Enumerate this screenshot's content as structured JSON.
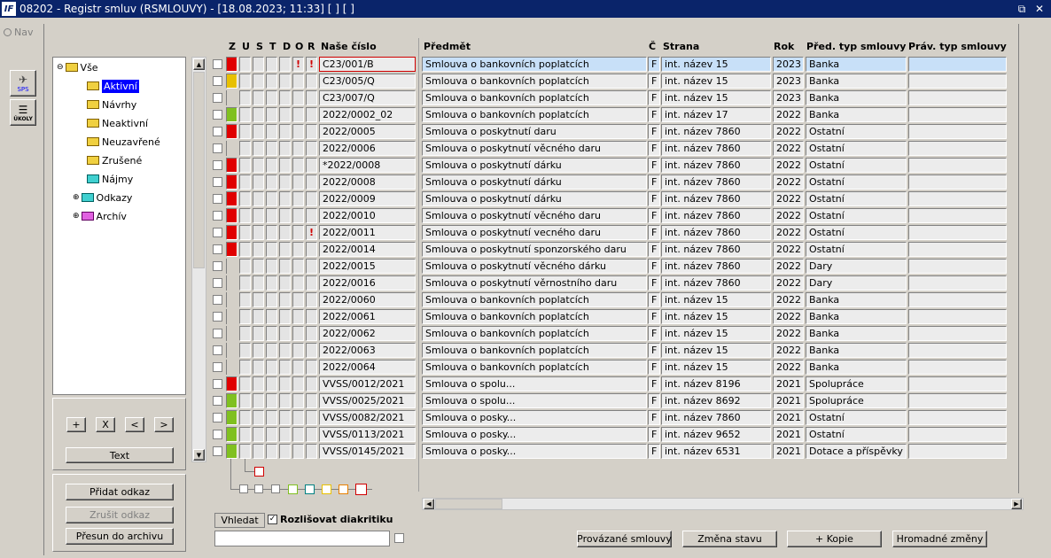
{
  "window": {
    "title": "08202 - Registr smluv (RSMLOUVY) - [18.08.2023; 11:33]  [ ] [ ]",
    "logo": "IF"
  },
  "nav": {
    "label": "Nav"
  },
  "side_icons": {
    "sps": "SPS",
    "ukoly": "ÚKOLY"
  },
  "tree": {
    "items": [
      "Vše",
      "Aktivní",
      "Návrhy",
      "Neaktivní",
      "Neuzavřené",
      "Zrušené",
      "Nájmy",
      "Odkazy",
      "Archív"
    ]
  },
  "tree_buttons": {
    "plus": "+",
    "x": "X",
    "lt": "<",
    "gt": ">",
    "text": "Text"
  },
  "link_buttons": {
    "add": "Přidat odkaz",
    "remove": "Zrušit odkaz",
    "archive": "Přesun do archivu"
  },
  "search": {
    "button": "Vhledat",
    "option": "Rozlišovat diakritiku",
    "value": ""
  },
  "status_letters": [
    "Z",
    "U",
    "S",
    "T",
    "D",
    "O",
    "R"
  ],
  "columns": {
    "cislo": "Naše číslo",
    "predmet": "Předmět",
    "c": "Č",
    "strana": "Strana",
    "rok": "Rok",
    "pred": "Před. typ smlouvy",
    "prav": "Práv. typ smlouvy"
  },
  "colors": {
    "red": "#e00000",
    "yellow": "#e8c000",
    "green": "#80c020",
    "titlebar": "#0a246a",
    "selection": "#0000ff"
  },
  "rows": [
    {
      "z": "red",
      "d": "!",
      "o": "!",
      "cislo": "C23/001/B",
      "predmet": "Smlouva o bankovních poplatcích",
      "c": "F",
      "strana": "int. název 15",
      "rok": "2023",
      "pred": "Banka"
    },
    {
      "z": "yellow",
      "cislo": "C23/005/Q",
      "predmet": "Smlouva o bankovních poplatcích",
      "c": "F",
      "strana": "int. název 15",
      "rok": "2023",
      "pred": "Banka"
    },
    {
      "z": "",
      "cislo": "C23/007/Q",
      "predmet": "Smlouva o bankovních poplatcích",
      "c": "F",
      "strana": "int. název 15",
      "rok": "2023",
      "pred": "Banka"
    },
    {
      "z": "green",
      "cislo": "2022/0002_02",
      "predmet": "Smlouva o bankovních poplatcích",
      "c": "F",
      "strana": "int. název 17",
      "rok": "2022",
      "pred": "Banka"
    },
    {
      "z": "red",
      "cislo": "2022/0005",
      "predmet": "Smlouva o poskytnutí daru",
      "c": "F",
      "strana": "int. název 7860",
      "rok": "2022",
      "pred": "Ostatní"
    },
    {
      "z": "",
      "cislo": "2022/0006",
      "predmet": "Smlouva o poskytnutí věcného daru",
      "c": "F",
      "strana": "int. název 7860",
      "rok": "2022",
      "pred": "Ostatní"
    },
    {
      "z": "red",
      "cislo": "*2022/0008",
      "predmet": "Smlouva o poskytnutí dárku",
      "c": "F",
      "strana": "int. název 7860",
      "rok": "2022",
      "pred": "Ostatní"
    },
    {
      "z": "red",
      "cislo": "2022/0008",
      "predmet": "Smlouva o poskytnutí dárku",
      "c": "F",
      "strana": "int. název 7860",
      "rok": "2022",
      "pred": "Ostatní"
    },
    {
      "z": "red",
      "cislo": "2022/0009",
      "predmet": "Smlouva o poskytnutí dárku",
      "c": "F",
      "strana": "int. název 7860",
      "rok": "2022",
      "pred": "Ostatní"
    },
    {
      "z": "red",
      "cislo": "2022/0010",
      "predmet": "Smlouva o poskytnutí věcného daru",
      "c": "F",
      "strana": "int. název 7860",
      "rok": "2022",
      "pred": "Ostatní"
    },
    {
      "z": "red",
      "o": "!",
      "cislo": "2022/0011",
      "predmet": "Smlouva o poskytnutí vecného daru",
      "c": "F",
      "strana": "int. název 7860",
      "rok": "2022",
      "pred": "Ostatní"
    },
    {
      "z": "red",
      "cislo": "2022/0014",
      "predmet": "Smlouva o poskytnutí sponzorského daru",
      "c": "F",
      "strana": "int. název 7860",
      "rok": "2022",
      "pred": "Ostatní"
    },
    {
      "z": "",
      "cislo": "2022/0015",
      "predmet": "Smlouva o poskytnutí věcného dárku",
      "c": "F",
      "strana": "int. název 7860",
      "rok": "2022",
      "pred": "Dary"
    },
    {
      "z": "",
      "cislo": "2022/0016",
      "predmet": "Smlouva o poskytnutí věrnostního daru",
      "c": "F",
      "strana": "int. název 7860",
      "rok": "2022",
      "pred": "Dary"
    },
    {
      "z": "",
      "cislo": "2022/0060",
      "predmet": "Smlouva o bankovních poplatcích",
      "c": "F",
      "strana": "int. název 15",
      "rok": "2022",
      "pred": "Banka"
    },
    {
      "z": "",
      "cislo": "2022/0061",
      "predmet": "Smlouva o bankovních poplatcích",
      "c": "F",
      "strana": "int. název 15",
      "rok": "2022",
      "pred": "Banka"
    },
    {
      "z": "",
      "cislo": "2022/0062",
      "predmet": "Smlouva o bankovních poplatcích",
      "c": "F",
      "strana": "int. název 15",
      "rok": "2022",
      "pred": "Banka"
    },
    {
      "z": "",
      "cislo": "2022/0063",
      "predmet": "Smlouva o bankovních poplatcích",
      "c": "F",
      "strana": "int. název 15",
      "rok": "2022",
      "pred": "Banka"
    },
    {
      "z": "",
      "cislo": "2022/0064",
      "predmet": "Smlouva o bankovních poplatcích",
      "c": "F",
      "strana": "int. název 15",
      "rok": "2022",
      "pred": "Banka"
    },
    {
      "z": "red",
      "cislo": "VVSS/0012/2021",
      "predmet": "Smlouva o spolu...",
      "c": "F",
      "strana": "int. název 8196",
      "rok": "2021",
      "pred": "Spolupráce"
    },
    {
      "z": "green",
      "cislo": "VVSS/0025/2021",
      "predmet": "Smlouva o spolu...",
      "c": "F",
      "strana": "int. název 8692",
      "rok": "2021",
      "pred": "Spolupráce"
    },
    {
      "z": "green",
      "cislo": "VVSS/0082/2021",
      "predmet": "Smlouva o posky...",
      "c": "F",
      "strana": "int. název 7860",
      "rok": "2021",
      "pred": "Ostatní"
    },
    {
      "z": "green",
      "cislo": "VVSS/0113/2021",
      "predmet": "Smlouva o posky...",
      "c": "F",
      "strana": "int. název 9652",
      "rok": "2021",
      "pred": "Ostatní"
    },
    {
      "z": "green",
      "cislo": "VVSS/0145/2021",
      "predmet": "Smlouva o posky...",
      "c": "F",
      "strana": "int. název 6531",
      "rok": "2021",
      "pred": "Dotace a příspěvky"
    }
  ],
  "bottom_buttons": {
    "linked": "Provázané smlouvy",
    "state": "Změna stavu",
    "copy": "+ Kopie",
    "bulk": "Hromadné změny"
  }
}
